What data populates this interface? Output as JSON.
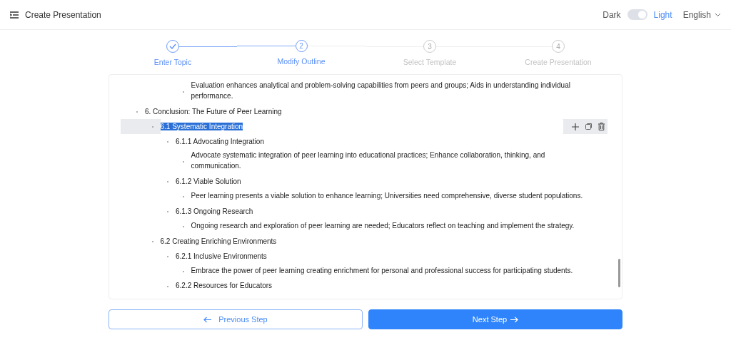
{
  "header": {
    "title": "Create Presentation",
    "theme": {
      "dark_label": "Dark",
      "light_label": "Light",
      "light_on": true
    },
    "language": "English"
  },
  "steps": [
    {
      "label": "Enter Topic",
      "done": true,
      "selected": false
    },
    {
      "number": "2",
      "label": "Modify Outline",
      "done": false,
      "selected": true
    },
    {
      "number": "3",
      "label": "Select Template",
      "done": false,
      "selected": false
    },
    {
      "number": "4",
      "label": "Create Presentation",
      "done": false,
      "selected": false
    }
  ],
  "outline": [
    {
      "children": [
        {
          "children": [
            {
              "children": [
                {
                  "text": "Evaluation enhances analytical and problem-solving capabilities from peers and groups; Aids in understanding individual performance.",
                  "selected": false
                }
              ]
            }
          ]
        }
      ]
    },
    {
      "text": "6. Conclusion: The Future of Peer Learning",
      "selected": false,
      "children": [
        {
          "text": "6.1 Systematic Integration",
          "selected": true,
          "children": [
            {
              "text": "6.1.1 Advocating Integration",
              "selected": false,
              "children": [
                {
                  "text": "Advocate systematic integration of peer learning into educational practices; Enhance collaboration, thinking, and communication.",
                  "selected": false
                }
              ]
            },
            {
              "text": "6.1.2 Viable Solution",
              "selected": false,
              "children": [
                {
                  "text": "Peer learning presents a viable solution to enhance learning; Universities need comprehensive, diverse student populations.",
                  "selected": false
                }
              ]
            },
            {
              "text": "6.1.3 Ongoing Research",
              "selected": false,
              "children": [
                {
                  "text": "Ongoing research and exploration of peer learning are needed; Educators reflect on teaching and implement the strategy.",
                  "selected": false
                }
              ]
            }
          ]
        },
        {
          "text": "6.2 Creating Enriching Environments",
          "selected": false,
          "children": [
            {
              "text": "6.2.1 Inclusive Environments",
              "selected": false,
              "children": [
                {
                  "text": "Embrace the power of peer learning creating enrichment for personal and professional success for participating students.",
                  "selected": false
                }
              ]
            },
            {
              "text": "6.2.2 Resources for Educators",
              "selected": false
            }
          ]
        }
      ]
    }
  ],
  "buttons": {
    "previous": "Previous Step",
    "next": "Next Step"
  }
}
